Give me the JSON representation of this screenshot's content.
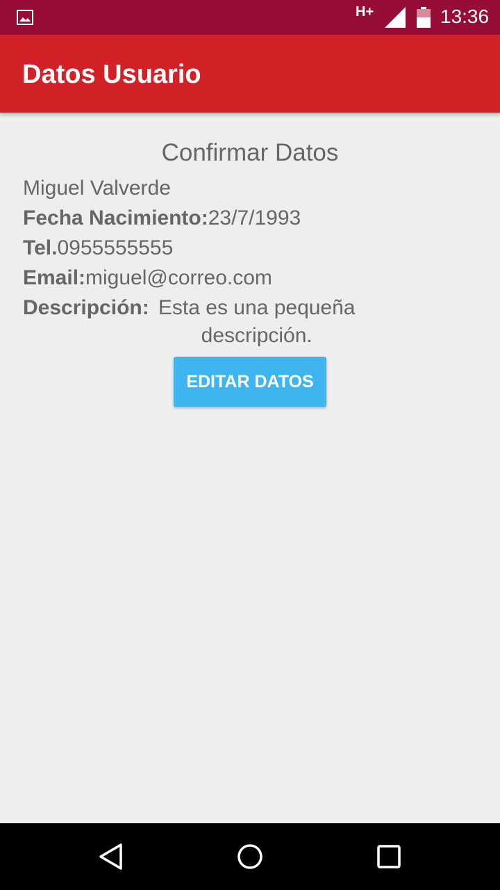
{
  "status_bar": {
    "network": "H+",
    "time": "13:36",
    "icons": [
      "image-icon",
      "signal-icon",
      "battery-icon"
    ],
    "background": "#960d36"
  },
  "app_bar": {
    "title": "Datos Usuario",
    "background": "#d32128"
  },
  "content": {
    "heading": "Confirmar Datos",
    "name": "Miguel Valverde",
    "birth_label": "Fecha Nacimiento:",
    "birth_value": "23/7/1993",
    "tel_label": "Tel.",
    "tel_value": "0955555555",
    "email_label": "Email:",
    "email_value": "miguel@correo.com",
    "desc_label": "Descripción:",
    "desc_value": "Esta es una pequeña descripción."
  },
  "button": {
    "label": "EDITAR DATOS",
    "color": "#3fb5ef"
  },
  "nav_bar": {
    "icons": [
      "back-icon",
      "home-icon",
      "recent-apps-icon"
    ]
  }
}
